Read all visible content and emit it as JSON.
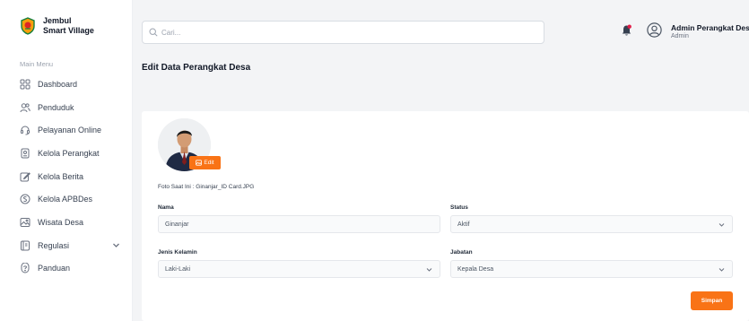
{
  "brand": {
    "line1": "Jembul",
    "line2": "Smart Village"
  },
  "sidebar": {
    "section_title": "Main Menu",
    "items": [
      {
        "label": "Dashboard",
        "icon": "grid-icon"
      },
      {
        "label": "Penduduk",
        "icon": "users-icon"
      },
      {
        "label": "Pelayanan Online",
        "icon": "headset-icon"
      },
      {
        "label": "Kelola Perangkat",
        "icon": "id-card-icon"
      },
      {
        "label": "Kelola Berita",
        "icon": "edit-icon"
      },
      {
        "label": "Kelola APBDes",
        "icon": "budget-icon"
      },
      {
        "label": "Wisata Desa",
        "icon": "image-icon"
      },
      {
        "label": "Regulasi",
        "icon": "book-icon"
      },
      {
        "label": "Panduan",
        "icon": "help-icon"
      }
    ]
  },
  "search": {
    "placeholder": "Cari..."
  },
  "user": {
    "name": "Admin Perangkat Desa",
    "role": "Admin"
  },
  "page": {
    "title": "Edit Data Perangkat Desa"
  },
  "form": {
    "edit_label": "Edit",
    "photo_caption": "Foto Saat Ini : Ginanjar_ID Card.JPG",
    "nama_label": "Nama",
    "nama_value": "Ginanjar",
    "status_label": "Status",
    "status_value": "Aktif",
    "gender_label": "Jenis Kelamin",
    "gender_value": "Laki-Laki",
    "jabatan_label": "Jabatan",
    "jabatan_value": "Kepala Desa",
    "save_label": "Simpan"
  },
  "colors": {
    "accent": "#f97316",
    "bell": "#e11d48"
  }
}
